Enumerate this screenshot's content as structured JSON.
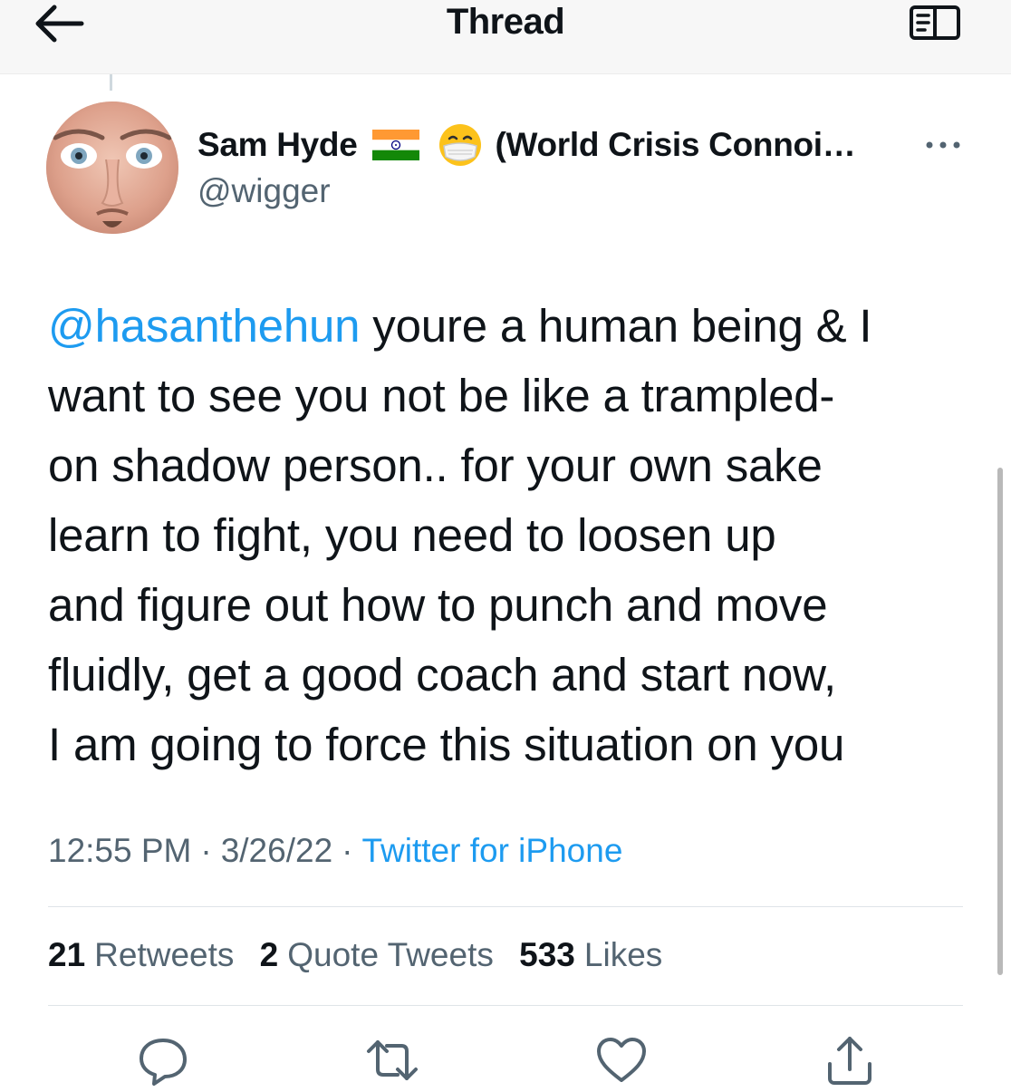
{
  "header": {
    "title": "Thread",
    "back_icon": "arrow-left-icon",
    "reader_icon": "reader-mode-icon"
  },
  "author": {
    "display_name": "Sam Hyde",
    "flag_icon": "india-flag-icon",
    "emoji_icon": "face-with-medical-mask-icon",
    "name_suffix": "(World Crisis Connoi…",
    "handle": "@wigger",
    "more_icon": "more-horizontal-icon"
  },
  "tweet": {
    "mention": "@hasanthehun",
    "lines": [
      " youre a human being & I",
      "want to see you not be like a trampled-",
      "on shadow person.. for your own sake",
      "learn to fight, you need to loosen up",
      "and figure out how to punch and move",
      "fluidly, get a good coach and start now,",
      "I am going to force this situation on you"
    ]
  },
  "meta": {
    "time": "12:55 PM",
    "separator": "·",
    "date": "3/26/22",
    "source": "Twitter for iPhone"
  },
  "stats": {
    "retweets_count": "21",
    "retweets_label": "Retweets",
    "quotes_count": "2",
    "quotes_label": "Quote Tweets",
    "likes_count": "533",
    "likes_label": "Likes"
  },
  "actions": {
    "reply_icon": "reply-icon",
    "retweet_icon": "retweet-icon",
    "like_icon": "heart-icon",
    "share_icon": "share-icon"
  },
  "colors": {
    "accent": "#1d9bf0",
    "text_primary": "#0f1419",
    "text_secondary": "#536471"
  }
}
